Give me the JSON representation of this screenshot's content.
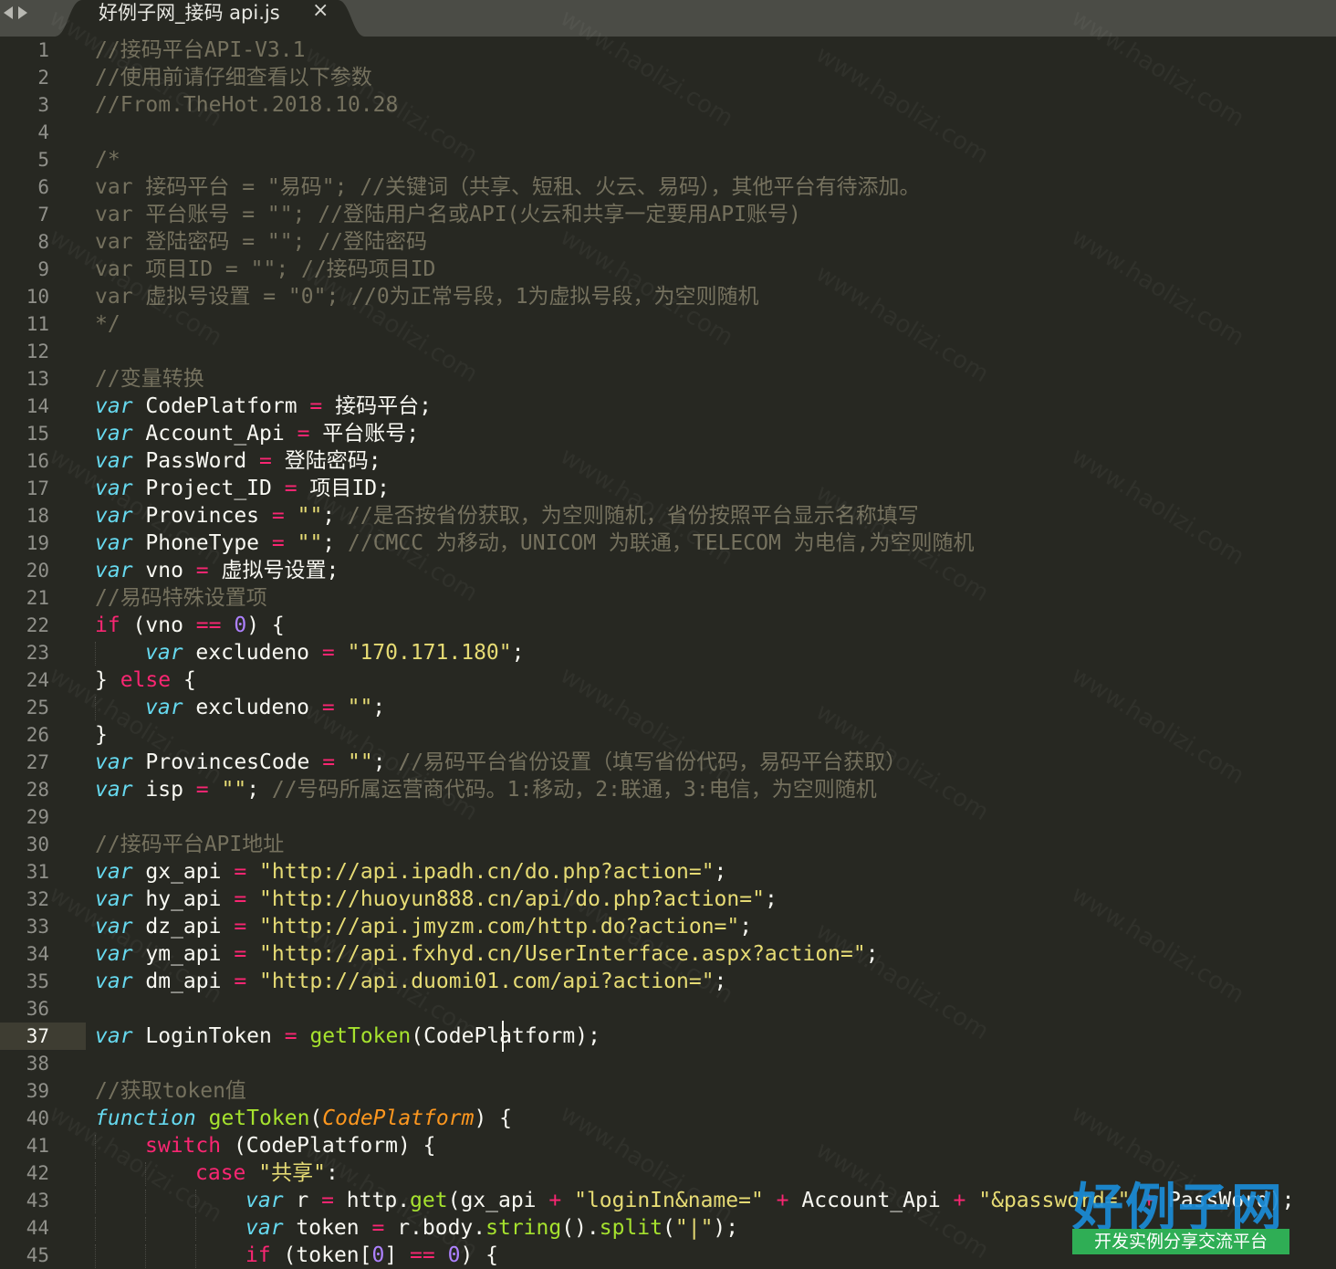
{
  "tab": {
    "title": "好例子网_接码 api.js",
    "close": "×"
  },
  "current_line": 37,
  "watermark": "www.haolizi.com",
  "logo": {
    "main": "好例子网",
    "sub": "开发实例分享交流平台"
  },
  "lines": [
    [
      [
        "c",
        "//接码平台API-V3.1"
      ]
    ],
    [
      [
        "c",
        "//使用前请仔细查看以下参数"
      ]
    ],
    [
      [
        "c",
        "//From.TheHot.2018.10.28"
      ]
    ],
    [],
    [
      [
        "c",
        "/*"
      ]
    ],
    [
      [
        "c",
        "var 接码平台 = \"易码\"; //关键词（共享、短租、火云、易码），其他平台有待添加。"
      ]
    ],
    [
      [
        "c",
        "var 平台账号 = \"\"; //登陆用户名或API(火云和共享一定要用API账号)"
      ]
    ],
    [
      [
        "c",
        "var 登陆密码 = \"\"; //登陆密码"
      ]
    ],
    [
      [
        "c",
        "var 项目ID = \"\"; //接码项目ID"
      ]
    ],
    [
      [
        "c",
        "var 虚拟号设置 = \"0\"; //0为正常号段，1为虚拟号段，为空则随机"
      ]
    ],
    [
      [
        "c",
        "*/"
      ]
    ],
    [],
    [
      [
        "c",
        "//变量转换"
      ]
    ],
    [
      [
        "v",
        "var"
      ],
      [
        "t",
        " CodePlatform "
      ],
      [
        "k",
        "="
      ],
      [
        "t",
        " 接码平台;"
      ]
    ],
    [
      [
        "v",
        "var"
      ],
      [
        "t",
        " Account_Api "
      ],
      [
        "k",
        "="
      ],
      [
        "t",
        " 平台账号;"
      ]
    ],
    [
      [
        "v",
        "var"
      ],
      [
        "t",
        " PassWord "
      ],
      [
        "k",
        "="
      ],
      [
        "t",
        " 登陆密码;"
      ]
    ],
    [
      [
        "v",
        "var"
      ],
      [
        "t",
        " Project_ID "
      ],
      [
        "k",
        "="
      ],
      [
        "t",
        " 项目ID;"
      ]
    ],
    [
      [
        "v",
        "var"
      ],
      [
        "t",
        " Provinces "
      ],
      [
        "k",
        "="
      ],
      [
        "t",
        " "
      ],
      [
        "s",
        "\"\""
      ],
      [
        "t",
        "; "
      ],
      [
        "c",
        "//是否按省份获取，为空则随机，省份按照平台显示名称填写"
      ]
    ],
    [
      [
        "v",
        "var"
      ],
      [
        "t",
        " PhoneType "
      ],
      [
        "k",
        "="
      ],
      [
        "t",
        " "
      ],
      [
        "s",
        "\"\""
      ],
      [
        "t",
        "; "
      ],
      [
        "c",
        "//CMCC 为移动，UNICOM 为联通，TELECOM 为电信,为空则随机"
      ]
    ],
    [
      [
        "v",
        "var"
      ],
      [
        "t",
        " vno "
      ],
      [
        "k",
        "="
      ],
      [
        "t",
        " 虚拟号设置;"
      ]
    ],
    [
      [
        "c",
        "//易码特殊设置项"
      ]
    ],
    [
      [
        "k",
        "if"
      ],
      [
        "t",
        " (vno "
      ],
      [
        "k",
        "=="
      ],
      [
        "t",
        " "
      ],
      [
        "n",
        "0"
      ],
      [
        "t",
        ") {"
      ]
    ],
    [
      [
        "g",
        ""
      ],
      [
        "v",
        "var"
      ],
      [
        "t",
        " excludeno "
      ],
      [
        "k",
        "="
      ],
      [
        "t",
        " "
      ],
      [
        "s",
        "\"170.171.180\""
      ],
      [
        "t",
        ";"
      ]
    ],
    [
      [
        "t",
        "} "
      ],
      [
        "k",
        "else"
      ],
      [
        "t",
        " {"
      ]
    ],
    [
      [
        "g",
        ""
      ],
      [
        "v",
        "var"
      ],
      [
        "t",
        " excludeno "
      ],
      [
        "k",
        "="
      ],
      [
        "t",
        " "
      ],
      [
        "s",
        "\"\""
      ],
      [
        "t",
        ";"
      ]
    ],
    [
      [
        "t",
        "}"
      ]
    ],
    [
      [
        "v",
        "var"
      ],
      [
        "t",
        " ProvincesCode "
      ],
      [
        "k",
        "="
      ],
      [
        "t",
        " "
      ],
      [
        "s",
        "\"\""
      ],
      [
        "t",
        "; "
      ],
      [
        "c",
        "//易码平台省份设置（填写省份代码，易码平台获取）"
      ]
    ],
    [
      [
        "v",
        "var"
      ],
      [
        "t",
        " isp "
      ],
      [
        "k",
        "="
      ],
      [
        "t",
        " "
      ],
      [
        "s",
        "\"\""
      ],
      [
        "t",
        "; "
      ],
      [
        "c",
        "//号码所属运营商代码。1:移动，2:联通，3:电信，为空则随机"
      ]
    ],
    [],
    [
      [
        "c",
        "//接码平台API地址"
      ]
    ],
    [
      [
        "v",
        "var"
      ],
      [
        "t",
        " gx_api "
      ],
      [
        "k",
        "="
      ],
      [
        "t",
        " "
      ],
      [
        "s",
        "\"http://api.ipadh.cn/do.php?action=\""
      ],
      [
        "t",
        ";"
      ]
    ],
    [
      [
        "v",
        "var"
      ],
      [
        "t",
        " hy_api "
      ],
      [
        "k",
        "="
      ],
      [
        "t",
        " "
      ],
      [
        "s",
        "\"http://huoyun888.cn/api/do.php?action=\""
      ],
      [
        "t",
        ";"
      ]
    ],
    [
      [
        "v",
        "var"
      ],
      [
        "t",
        " dz_api "
      ],
      [
        "k",
        "="
      ],
      [
        "t",
        " "
      ],
      [
        "s",
        "\"http://api.jmyzm.com/http.do?action=\""
      ],
      [
        "t",
        ";"
      ]
    ],
    [
      [
        "v",
        "var"
      ],
      [
        "t",
        " ym_api "
      ],
      [
        "k",
        "="
      ],
      [
        "t",
        " "
      ],
      [
        "s",
        "\"http://api.fxhyd.cn/UserInterface.aspx?action=\""
      ],
      [
        "t",
        ";"
      ]
    ],
    [
      [
        "v",
        "var"
      ],
      [
        "t",
        " dm_api "
      ],
      [
        "k",
        "="
      ],
      [
        "t",
        " "
      ],
      [
        "s",
        "\"http://api.duomi01.com/api?action=\""
      ],
      [
        "t",
        ";"
      ]
    ],
    [],
    [
      [
        "v",
        "var"
      ],
      [
        "t",
        " LoginToken "
      ],
      [
        "k",
        "="
      ],
      [
        "t",
        " "
      ],
      [
        "f",
        "getToken"
      ],
      [
        "t",
        "(CodePlatform);"
      ]
    ],
    [],
    [
      [
        "c",
        "//获取token值"
      ]
    ],
    [
      [
        "v",
        "function"
      ],
      [
        "t",
        " "
      ],
      [
        "f",
        "getToken"
      ],
      [
        "t",
        "("
      ],
      [
        "p",
        "CodePlatform"
      ],
      [
        "t",
        ") {"
      ]
    ],
    [
      [
        "g",
        ""
      ],
      [
        "k",
        "switch"
      ],
      [
        "t",
        " (CodePlatform) {"
      ]
    ],
    [
      [
        "g",
        ""
      ],
      [
        "g",
        ""
      ],
      [
        "k",
        "case"
      ],
      [
        "t",
        " "
      ],
      [
        "s",
        "\"共享\""
      ],
      [
        "t",
        ":"
      ]
    ],
    [
      [
        "g",
        ""
      ],
      [
        "g",
        ""
      ],
      [
        "g",
        ""
      ],
      [
        "v",
        "var"
      ],
      [
        "t",
        " r "
      ],
      [
        "k",
        "="
      ],
      [
        "t",
        " http."
      ],
      [
        "f",
        "get"
      ],
      [
        "t",
        "(gx_api "
      ],
      [
        "k",
        "+"
      ],
      [
        "t",
        " "
      ],
      [
        "s",
        "\"loginIn&name=\""
      ],
      [
        "t",
        " "
      ],
      [
        "k",
        "+"
      ],
      [
        "t",
        " Account_Api "
      ],
      [
        "k",
        "+"
      ],
      [
        "t",
        " "
      ],
      [
        "s",
        "\"&password=\""
      ],
      [
        "t",
        " "
      ],
      [
        "k",
        "+"
      ],
      [
        "t",
        " PassWord);"
      ]
    ],
    [
      [
        "g",
        ""
      ],
      [
        "g",
        ""
      ],
      [
        "g",
        ""
      ],
      [
        "v",
        "var"
      ],
      [
        "t",
        " token "
      ],
      [
        "k",
        "="
      ],
      [
        "t",
        " r.body."
      ],
      [
        "f",
        "string"
      ],
      [
        "t",
        "()."
      ],
      [
        "f",
        "split"
      ],
      [
        "t",
        "("
      ],
      [
        "s",
        "\"|\""
      ],
      [
        "t",
        ");"
      ]
    ],
    [
      [
        "g",
        ""
      ],
      [
        "g",
        ""
      ],
      [
        "g",
        ""
      ],
      [
        "k",
        "if"
      ],
      [
        "t",
        " (token["
      ],
      [
        "n",
        "0"
      ],
      [
        "t",
        "] "
      ],
      [
        "k",
        "=="
      ],
      [
        "t",
        " "
      ],
      [
        "n",
        "0"
      ],
      [
        "t",
        ") {"
      ]
    ]
  ]
}
